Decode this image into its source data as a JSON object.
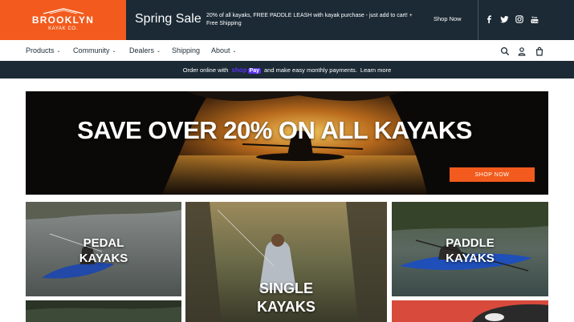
{
  "brand": {
    "name": "BROOKLYN",
    "sub": "KAYAK CO."
  },
  "announcement": {
    "title": "Spring Sale",
    "text": "20% of all kayaks, FREE PADDLE LEASH with kayak purchase - just add to cart! + Free Shipping",
    "link": "Shop Now"
  },
  "social": [
    "facebook-icon",
    "twitter-icon",
    "instagram-icon",
    "youtube-icon"
  ],
  "nav": {
    "items": [
      {
        "label": "Products",
        "dropdown": true
      },
      {
        "label": "Community",
        "dropdown": true
      },
      {
        "label": "Dealers",
        "dropdown": true
      },
      {
        "label": "Shipping",
        "dropdown": false
      },
      {
        "label": "About",
        "dropdown": true
      }
    ],
    "icons": [
      "search-icon",
      "account-icon",
      "cart-icon"
    ]
  },
  "promo": {
    "before": "Order online with",
    "shoppay": "shop",
    "shoppay_tag": "Pay",
    "after": "and make easy monthly payments.",
    "link": "Learn more"
  },
  "hero": {
    "title": "SAVE OVER 20% ON ALL KAYAKS",
    "button": "SHOP NOW"
  },
  "tiles": [
    {
      "label_line1": "PEDAL",
      "label_line2": "KAYAKS"
    },
    {
      "label_line1": "SINGLE",
      "label_line2": "KAYAKS"
    },
    {
      "label_line1": "PADDLE",
      "label_line2": "KAYAKS"
    }
  ],
  "colors": {
    "accent": "#f25b1d",
    "dark": "#1b2a35",
    "shoppay": "#5a31f4"
  }
}
